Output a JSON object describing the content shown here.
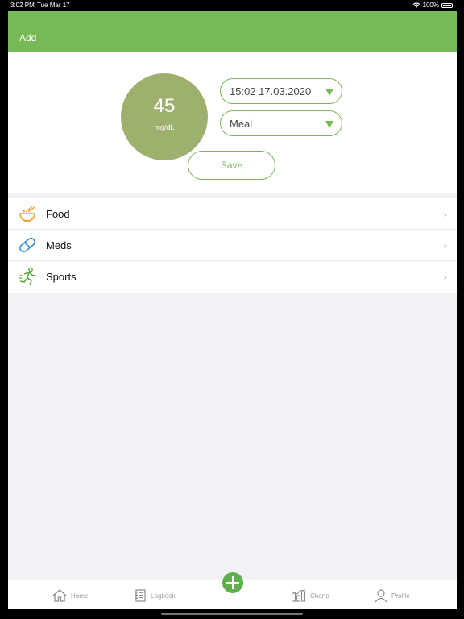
{
  "status": {
    "time": "3:02 PM",
    "date": "Tue Mar 17",
    "battery": "100%"
  },
  "header": {
    "title": "Add"
  },
  "entry": {
    "value": "45",
    "unit": "mg/dL",
    "datetime_label": "15:02   17.03.2020",
    "type_label": "Meal",
    "save_label": "Save",
    "circle_color": "#9eb06d",
    "accent_color": "#77b957"
  },
  "list": [
    {
      "label": "Food",
      "icon": "food-bowl-icon"
    },
    {
      "label": "Meds",
      "icon": "pill-icon"
    },
    {
      "label": "Sports",
      "icon": "running-icon"
    }
  ],
  "tabs": {
    "home": "Home",
    "logbook": "Logbook",
    "charts": "Charts",
    "profile": "Profile"
  }
}
